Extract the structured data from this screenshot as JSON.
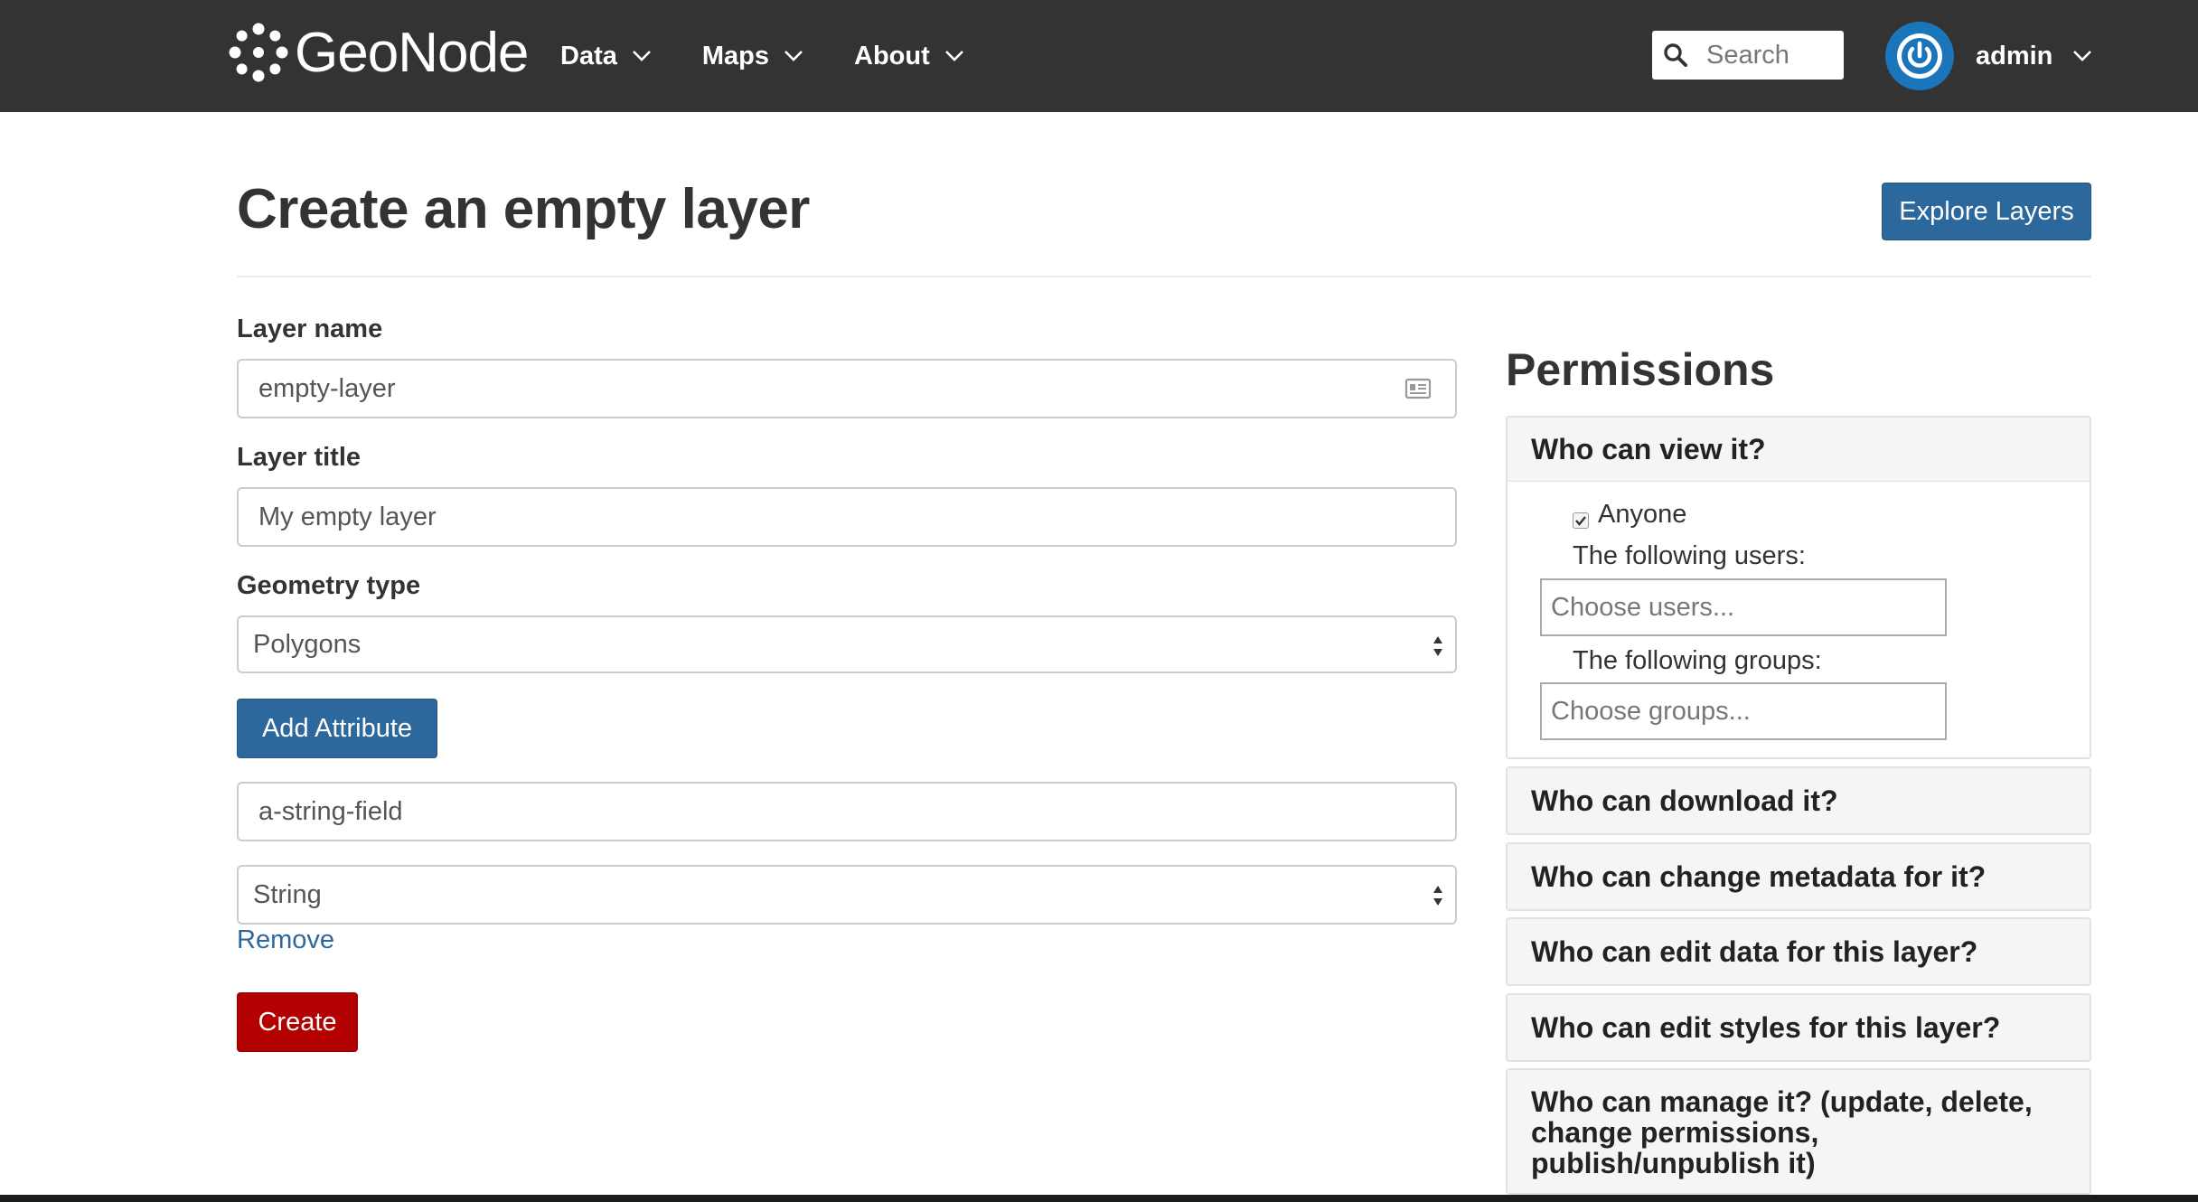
{
  "navbar": {
    "brand": "GeoNode",
    "menu": [
      {
        "label": "Data"
      },
      {
        "label": "Maps"
      },
      {
        "label": "About"
      }
    ],
    "search_placeholder": "Search",
    "user": "admin"
  },
  "page": {
    "title": "Create an empty layer",
    "explore_button": "Explore Layers"
  },
  "form": {
    "layer_name_label": "Layer name",
    "layer_name_value": "empty-layer",
    "layer_title_label": "Layer title",
    "layer_title_value": "My empty layer",
    "geometry_label": "Geometry type",
    "geometry_value": "Polygons",
    "add_attribute": "Add Attribute",
    "attribute_name_value": "a-string-field",
    "attribute_type_value": "String",
    "remove": "Remove",
    "create": "Create"
  },
  "permissions": {
    "title": "Permissions",
    "view": {
      "header": "Who can view it?",
      "anyone_label": "Anyone",
      "anyone_checked": true,
      "users_label": "The following users:",
      "users_placeholder": "Choose users...",
      "groups_label": "The following groups:",
      "groups_placeholder": "Choose groups..."
    },
    "download": "Who can download it?",
    "metadata": "Who can change metadata for it?",
    "edit_data": "Who can edit data for this layer?",
    "edit_styles": "Who can edit styles for this layer?",
    "manage": "Who can manage it? (update, delete, change permissions, publish/unpublish it)"
  },
  "colors": {
    "navbar": "#333333",
    "primary": "#2c689c",
    "danger": "#b30000",
    "avatar": "#1b75bb"
  }
}
